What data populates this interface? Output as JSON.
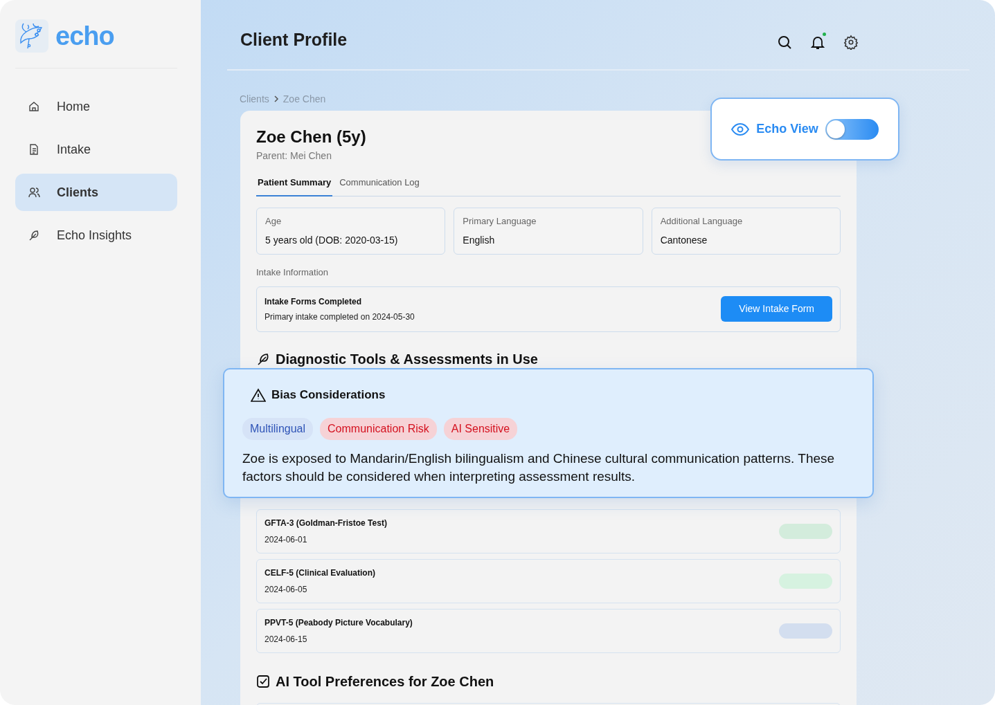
{
  "app": {
    "name": "echo"
  },
  "sidebar": {
    "items": [
      {
        "label": "Home",
        "selected": false
      },
      {
        "label": "Intake",
        "selected": false
      },
      {
        "label": "Clients",
        "selected": true
      },
      {
        "label": "Echo Insights",
        "selected": false
      }
    ]
  },
  "header": {
    "title": "Client Profile",
    "notification_dot": true
  },
  "breadcrumb": [
    "Clients",
    "Zoe Chen"
  ],
  "echo_view": {
    "label": "Echo View",
    "on": false
  },
  "profile": {
    "name": "Zoe Chen (5y)",
    "parent": "Parent: Mei Chen",
    "tabs": [
      {
        "label": "Patient Summary",
        "selected": true
      },
      {
        "label": "Communication Log",
        "selected": false
      }
    ],
    "fields": [
      {
        "label": "Age",
        "value": "5 years old (DOB: 2020-03-15)"
      },
      {
        "label": "Primary Language",
        "value": "English"
      },
      {
        "label": "Additional Language",
        "value": "Cantonese"
      }
    ],
    "intake": {
      "section": "Intake Information",
      "title": "Intake Forms Completed",
      "detail": "Primary intake completed on 2024-05-30",
      "button": "View Intake Form"
    },
    "diagnostics_title": "Diagnostic Tools & Assessments in Use",
    "assessments": [
      {
        "name": "GFTA-3 (Goldman-Fristoe Test)",
        "date": "2024-06-01",
        "color": "#d3ecdc"
      },
      {
        "name": "CELF-5 (Clinical Evaluation)",
        "date": "2024-06-05",
        "color": "#d6f2e0"
      },
      {
        "name": "PPVT-5 (Peabody Picture Vocabulary)",
        "date": "2024-06-15",
        "color": "#d3deef"
      }
    ],
    "preferences_title": "AI Tool Preferences for Zoe Chen"
  },
  "bias": {
    "title": "Bias Considerations",
    "tags": [
      {
        "label": "Multilingual",
        "kind": "info"
      },
      {
        "label": "Communication Risk",
        "kind": "risk"
      },
      {
        "label": "AI Sensitive",
        "kind": "risk"
      }
    ],
    "text": "Zoe is exposed to Mandarin/English bilingualism and Chinese cultural communication patterns. These factors should be considered when interpreting assessment results."
  }
}
